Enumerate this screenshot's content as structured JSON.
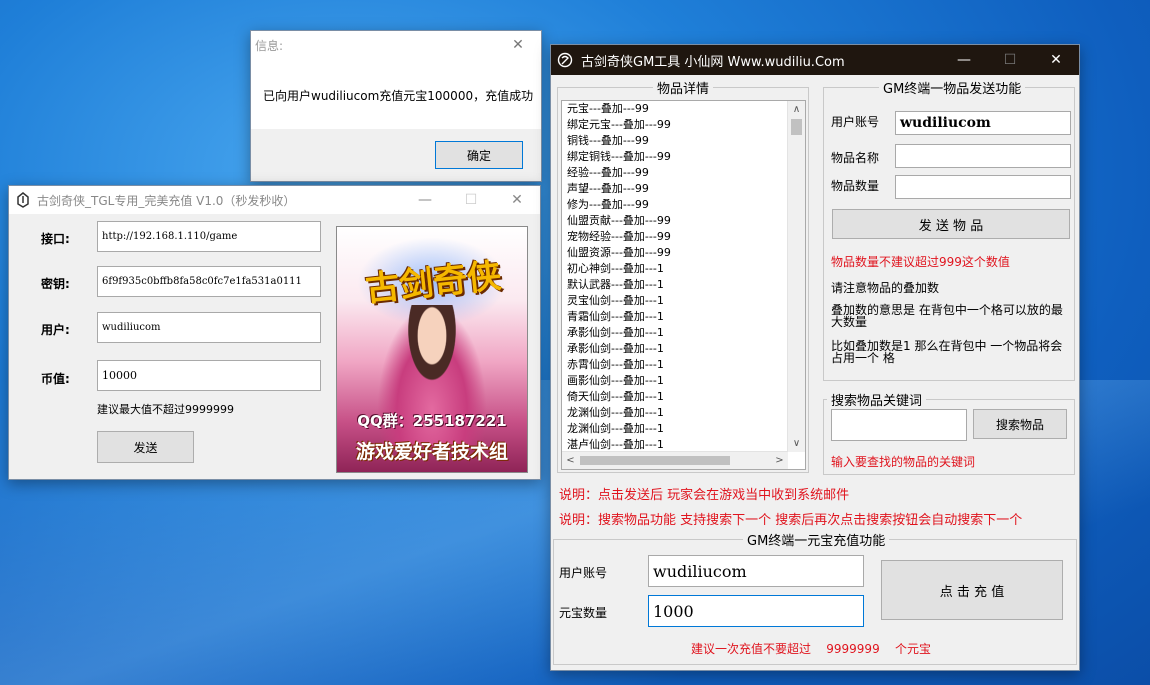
{
  "info_dialog": {
    "title": "信息:",
    "message": "已向用户wudiliucom充值元宝100000，充值成功",
    "ok_label": "确定",
    "close_glyph": "✕"
  },
  "recharge_window": {
    "title": "古剑奇侠_TGL专用_完美充值 V1.0（秒发秒收）",
    "minimize_glyph": "—",
    "maximize_glyph": "☐",
    "close_glyph": "✕",
    "endpoint_label": "接口:",
    "endpoint_value": "http://192.168.1.110/game",
    "key_label": "密钥:",
    "key_value": "6f9f935c0bffb8fa58c0fc7e1fa531a0111",
    "user_label": "用户:",
    "user_value": "wudiliucom",
    "amount_label": "币值:",
    "amount_value": "10000",
    "hint": "建议最大值不超过9999999",
    "send_label": "发送",
    "banner": {
      "logo_text": "古剑奇侠",
      "qq_text": "QQ群：255187221",
      "group_text": "游戏爱好者技术组"
    }
  },
  "gm_window": {
    "title": "古剑奇侠GM工具 小仙网 Www.wudiliu.Com",
    "minimize_glyph": "—",
    "maximize_glyph": "☐",
    "close_glyph": "✕",
    "items_group_title": "物品详情",
    "items": [
      "元宝---叠加---99",
      "绑定元宝---叠加---99",
      "铜钱---叠加---99",
      "绑定铜钱---叠加---99",
      "经验---叠加---99",
      "声望---叠加---99",
      "修为---叠加---99",
      "仙盟贡献---叠加---99",
      "宠物经验---叠加---99",
      "仙盟资源---叠加---99",
      "初心神剑---叠加---1",
      "默认武器---叠加---1",
      "灵宝仙剑---叠加---1",
      "青霜仙剑---叠加---1",
      "承影仙剑---叠加---1",
      "承影仙剑---叠加---1",
      "赤霄仙剑---叠加---1",
      "画影仙剑---叠加---1",
      "倚天仙剑---叠加---1",
      "龙渊仙剑---叠加---1",
      "龙渊仙剑---叠加---1",
      "湛卢仙剑---叠加---1"
    ],
    "send_group_title": "GM终端一物品发送功能",
    "account_label": "用户账号",
    "account_value": "wudiliucom",
    "item_name_label": "物品名称",
    "item_name_value": "",
    "item_qty_label": "物品数量",
    "item_qty_value": "",
    "send_item_label": "发 送 物 品",
    "warn_qty": "物品数量不建议超过999这个数值",
    "note_stack": "请注意物品的叠加数",
    "note_stack_meaning": "叠加数的意思是 在背包中一个格可以放的最大数量",
    "note_stack_example": "比如叠加数是1  那么在背包中 一个物品将会占用一个 格",
    "search_group_title": "搜索物品关键词",
    "search_value": "",
    "search_button_label": "搜索物品",
    "search_hint": "输入要查找的物品的关键词",
    "notice_1": "说明：点击发送后 玩家会在游戏当中收到系统邮件",
    "notice_2": "说明：搜索物品功能 支持搜索下一个   搜索后再次点击搜索按钮会自动搜索下一个",
    "yuanbao_group_title": "GM终端一元宝充值功能",
    "yb_account_label": "用户账号",
    "yb_account_value": "wudiliucom",
    "yb_qty_label": "元宝数量",
    "yb_qty_value": "1000",
    "recharge_button_label": "点 击 充  值",
    "yb_hint": "建议一次充值不要超过    9999999    个元宝"
  }
}
